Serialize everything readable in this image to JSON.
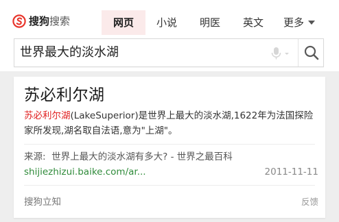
{
  "brand": {
    "name_part1": "搜狗",
    "name_part2": "搜索",
    "color": "#e8352b"
  },
  "tabs": [
    {
      "label": "网页",
      "active": true
    },
    {
      "label": "小说",
      "active": false
    },
    {
      "label": "明医",
      "active": false
    },
    {
      "label": "英文",
      "active": false
    },
    {
      "label": "更多",
      "active": false
    }
  ],
  "search": {
    "query": "世界最大的淡水湖",
    "mic_icon": "microphone-icon",
    "search_icon": "magnifier-icon"
  },
  "result": {
    "title": "苏必利尔湖",
    "snippet_highlight": "苏必利尔湖",
    "snippet_rest_line": "(LakeSuperior)是世界上最大的淡水湖,1622年为法国探险家所发现,湖名取自法语,意为\"上湖\"。",
    "source_label": "来源:",
    "source_title": "世界上最大的淡水湖有多大? - 世界之最百科",
    "source_url": "shijiezhizui.baike.com/ar...",
    "date": "2011-11-11",
    "footer_left": "搜狗立知",
    "footer_right": "反馈"
  },
  "colors": {
    "highlight": "#e02020",
    "url_green": "#2f8b3a",
    "active_tab_bg": "#fbeaea",
    "page_grey": "#eeeeee"
  }
}
